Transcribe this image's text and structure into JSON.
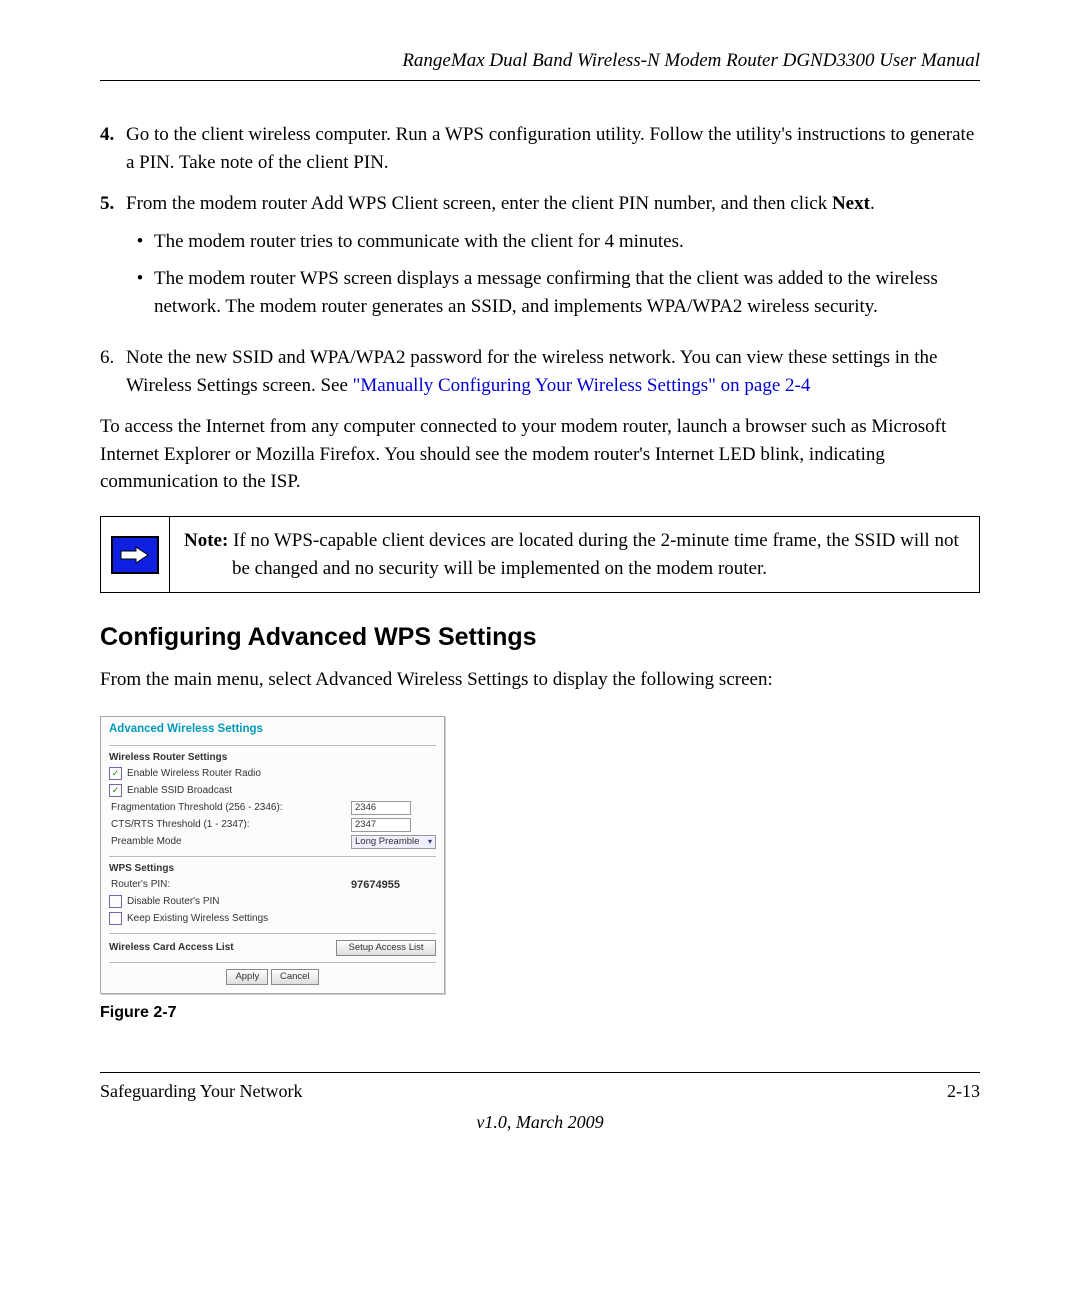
{
  "header": {
    "running_title": "RangeMax Dual Band Wireless-N Modem Router DGND3300 User Manual"
  },
  "steps": {
    "s4": {
      "num": "4.",
      "text": "Go to the client wireless computer. Run a WPS configuration utility. Follow the utility's instructions to generate a PIN. Take note of the client PIN."
    },
    "s5": {
      "num": "5.",
      "text_a": "From the modem router Add WPS Client screen, enter the client PIN number, and then click ",
      "text_bold": "Next",
      "text_c": ".",
      "bullets": {
        "b1": "The modem router tries to communicate with the client for 4 minutes.",
        "b2": "The modem router WPS screen displays a message confirming that the client was added to the wireless network. The modem router generates an SSID, and implements WPA/WPA2 wireless security."
      }
    },
    "s6": {
      "num": "6.",
      "text_a": "Note the new SSID and WPA/WPA2 password for the wireless network. You can view these settings in the Wireless Settings screen. See ",
      "link": "\"Manually Configuring Your Wireless Settings\" on page 2-4"
    }
  },
  "body_para": "To access the Internet from any computer connected to your modem router, launch a browser such as Microsoft Internet Explorer or Mozilla Firefox. You should see the modem router's Internet LED blink, indicating communication to the ISP.",
  "note": {
    "label": "Note:",
    "text": " If no WPS-capable client devices are located during the 2-minute time frame, the SSID will not be changed and no security will be implemented on the modem router."
  },
  "section_heading": "Configuring Advanced WPS Settings",
  "section_intro": "From the main menu, select Advanced Wireless Settings to display the following screen:",
  "ui": {
    "title": "Advanced Wireless Settings",
    "wrs_heading": "Wireless Router Settings",
    "enable_radio": "Enable Wireless Router Radio",
    "enable_ssid": "Enable SSID Broadcast",
    "frag_label": "Fragmentation Threshold (256 - 2346):",
    "frag_value": "2346",
    "cts_label": "CTS/RTS Threshold (1 - 2347):",
    "cts_value": "2347",
    "preamble_label": "Preamble Mode",
    "preamble_value": "Long Preamble",
    "wps_heading": "WPS Settings",
    "router_pin_label": "Router's PIN:",
    "router_pin_value": "97674955",
    "disable_pin": "Disable Router's PIN",
    "keep_existing": "Keep Existing Wireless Settings",
    "access_list_heading": "Wireless Card Access List",
    "setup_access_btn": "Setup Access List",
    "apply_btn": "Apply",
    "cancel_btn": "Cancel"
  },
  "figure_caption": "Figure 2-7",
  "footer": {
    "left": "Safeguarding Your Network",
    "right": "2-13",
    "version": "v1.0, March 2009"
  }
}
